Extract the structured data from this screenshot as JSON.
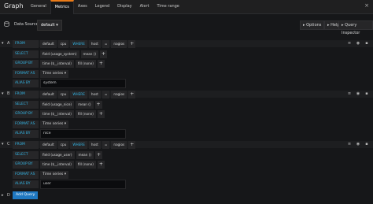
{
  "app": {
    "title": "Graph"
  },
  "tabs": [
    {
      "label": "General",
      "active": false
    },
    {
      "label": "Metrics",
      "active": true
    },
    {
      "label": "Axes",
      "active": false
    },
    {
      "label": "Legend",
      "active": false
    },
    {
      "label": "Display",
      "active": false
    },
    {
      "label": "Alert",
      "active": false
    },
    {
      "label": "Time range",
      "active": false
    }
  ],
  "close_glyph": "×",
  "datasource": {
    "label": "Data Source",
    "value": "default",
    "caret": "▾",
    "options_label": "Options",
    "help_label": "Help",
    "inspector_label": "Query Inspector"
  },
  "keywords": {
    "from": "FROM",
    "select": "SELECT",
    "group_by": "GROUP BY",
    "format_as": "FORMAT AS",
    "alias_by": "ALIAS BY",
    "where": "WHERE"
  },
  "queries": [
    {
      "letter": "A",
      "from": {
        "policy": "default",
        "measurement": "cpu",
        "tag_key": "host",
        "operator": "=",
        "tag_value": "nagios"
      },
      "select": {
        "field": "field (usage_system)",
        "agg": "mean ()"
      },
      "group_by": {
        "time": "time ($__interval)",
        "fill": "fill (none)"
      },
      "format": "Time series",
      "alias": "system"
    },
    {
      "letter": "B",
      "from": {
        "policy": "default",
        "measurement": "cpu",
        "tag_key": "host",
        "operator": "=",
        "tag_value": "nagios"
      },
      "select": {
        "field": "field (usage_nice)",
        "agg": "mean ()"
      },
      "group_by": {
        "time": "time ($__interval)",
        "fill": "fill (none)"
      },
      "format": "Time series",
      "alias": "nice"
    },
    {
      "letter": "C",
      "from": {
        "policy": "default",
        "measurement": "cpu",
        "tag_key": "host",
        "operator": "=",
        "tag_value": "nagios"
      },
      "select": {
        "field": "field (usage_user)",
        "agg": "mean ()"
      },
      "group_by": {
        "time": "time ($__interval)",
        "fill": "fill (none)"
      },
      "format": "Time series",
      "alias": "user"
    }
  ],
  "next_letter": "D",
  "add_query_label": "Add Query",
  "colors": {
    "accent": "#eb7b18",
    "keyword": "#33b5e5",
    "primary_button": "#1f78c1"
  }
}
